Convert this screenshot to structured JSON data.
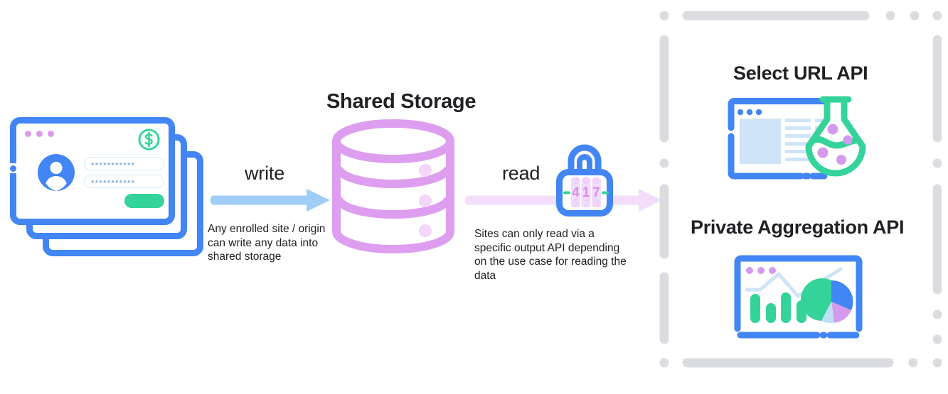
{
  "diagram": {
    "title_center": "Shared Storage",
    "write": {
      "label": "write",
      "caption": "Any enrolled site / origin can write any data into shared storage",
      "arrow_color": "#9fcdf8",
      "icon": "right-arrow-icon"
    },
    "read": {
      "label": "read",
      "caption": "Sites can only read via a specific output API depending on the use case for reading the data",
      "arrow_color": "#f2ddfb",
      "icon": "right-arrow-icon"
    },
    "sites": {
      "icon": "stacked-browser-windows-icon",
      "window_dots": 3,
      "badge_icon": "dollar-circle-icon",
      "avatar_icon": "user-avatar-icon",
      "field_1_value": "•••••••••••",
      "field_2_value": "•••••••••••",
      "submit_label": ""
    },
    "storage": {
      "icon": "database-cylinder-icon",
      "tiers": 3,
      "color": "#de9ef0"
    },
    "lock": {
      "icon": "combination-padlock-icon",
      "combination": "417",
      "body_color": "#4285f4",
      "digit_color": "#de9ef0"
    },
    "apis": [
      {
        "title": "Select URL API",
        "icon": "browser-window-with-flask-icon",
        "window_dots": 3,
        "flask_color": "#34d399",
        "sample_dots": 4
      },
      {
        "title": "Private Aggregation API",
        "icon": "analytics-dashboard-icon",
        "window_dots": 3,
        "bars": [
          1.0,
          0.66,
          0.95,
          0.6
        ],
        "bar_color": "#34d399",
        "pie_slices": [
          {
            "label": "green",
            "color": "#34d399",
            "percent": 50
          },
          {
            "label": "blue",
            "color": "#4285f4",
            "percent": 20
          },
          {
            "label": "purple",
            "color": "#d49bec",
            "percent": 18
          },
          {
            "label": "light-blue",
            "color": "#bfdff5",
            "percent": 12
          }
        ]
      }
    ],
    "panel": {
      "border_style": "dashed-rounded-rectangle",
      "border_color": "#dadce0"
    }
  }
}
